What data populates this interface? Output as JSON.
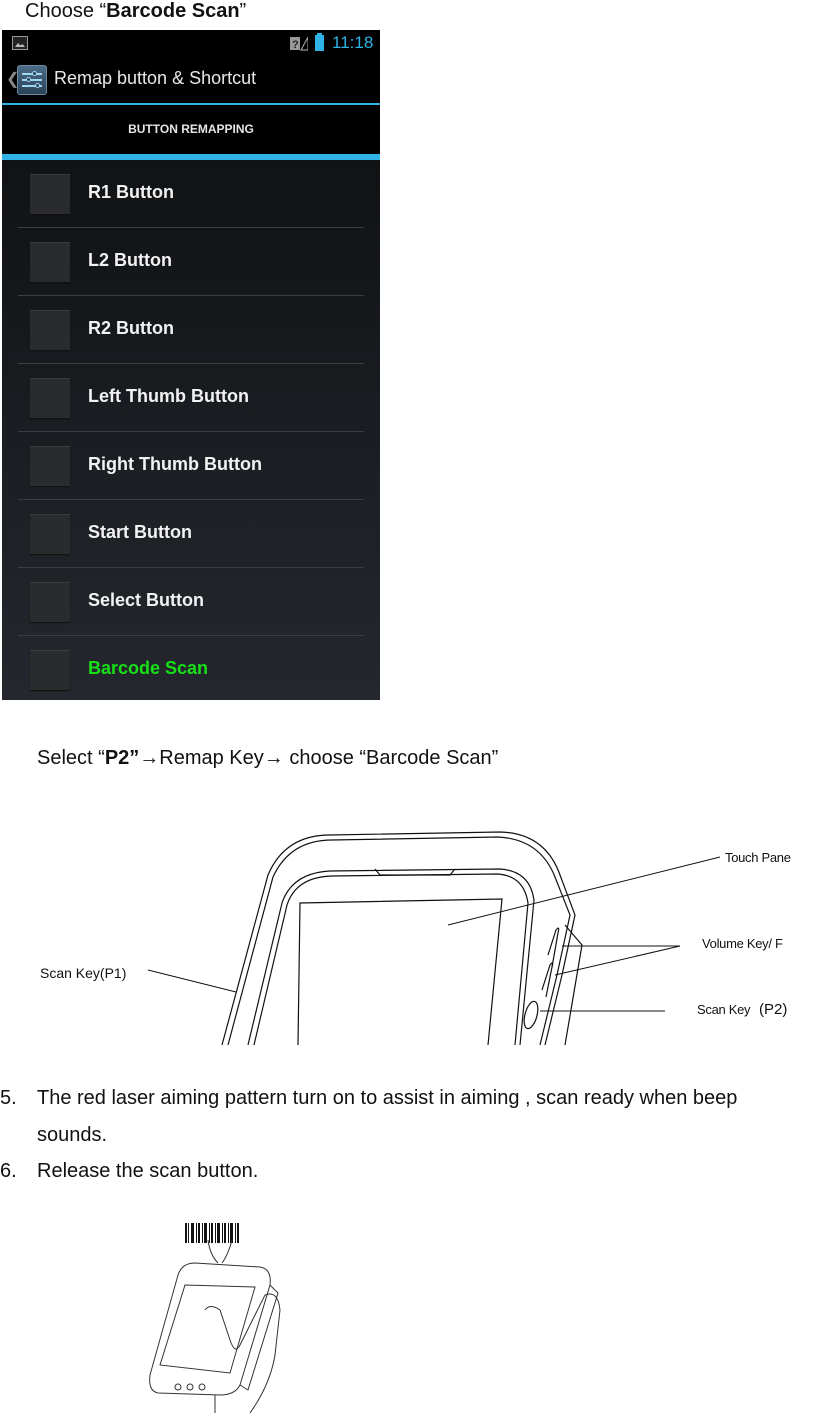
{
  "intro": {
    "prefix": "Choose “",
    "bold": "Barcode Scan",
    "suffix": "”"
  },
  "phone": {
    "statusbar": {
      "left_icon": "gallery-icon",
      "right_icons": [
        "sim-unknown-icon",
        "battery-icon"
      ],
      "time": "11:18",
      "accent_color": "#2fb3e6"
    },
    "actionbar": {
      "back_icon": "back-chevron-icon",
      "app_icon": "settings-sliders-icon",
      "title": "Remap button & Shortcut"
    },
    "section_header": "BUTTON REMAPPING",
    "items": [
      {
        "label": "R1 Button",
        "checked": false,
        "selected": false
      },
      {
        "label": "L2 Button",
        "checked": false,
        "selected": false
      },
      {
        "label": "R2 Button",
        "checked": false,
        "selected": false
      },
      {
        "label": "Left Thumb Button",
        "checked": false,
        "selected": false
      },
      {
        "label": "Right Thumb Button",
        "checked": false,
        "selected": false
      },
      {
        "label": "Start Button",
        "checked": false,
        "selected": false
      },
      {
        "label": "Select Button",
        "checked": false,
        "selected": false
      },
      {
        "label": "Barcode Scan",
        "checked": false,
        "selected": true
      }
    ],
    "selected_color": "#16e016"
  },
  "instruction": {
    "prefix": "Select “",
    "bold": "P2”",
    "arrow1": "→",
    "mid": "Remap Key",
    "arrow2": "→",
    "suffix": " choose “Barcode Scan”"
  },
  "diagram": {
    "labels": {
      "scan_key_p1": "Scan Key(P1)",
      "touch_panel": "Touch Pane",
      "volume_key": "Volume Key/ F",
      "scan_key": "Scan Key",
      "scan_key_p2": "(P2)"
    }
  },
  "steps": [
    {
      "number": "5.",
      "lines": [
        "The red laser aiming pattern turn on to assist in aiming , scan ready when beep",
        "sounds."
      ]
    },
    {
      "number": "6.",
      "lines": [
        "Release the scan button."
      ]
    }
  ]
}
